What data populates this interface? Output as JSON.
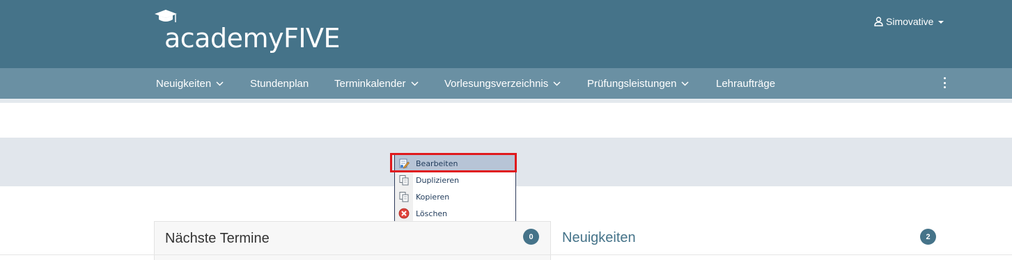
{
  "header": {
    "logo_text": "academyFIVE",
    "user_name": "Simovative",
    "colors": {
      "header_bg": "#457389",
      "nav_bg": "#6a90a3"
    }
  },
  "nav": {
    "items": [
      {
        "label": "Neuigkeiten",
        "has_dropdown": true
      },
      {
        "label": "Stundenplan",
        "has_dropdown": false
      },
      {
        "label": "Terminkalender",
        "has_dropdown": true
      },
      {
        "label": "Vorlesungsverzeichnis",
        "has_dropdown": true
      },
      {
        "label": "Prüfungsleistungen",
        "has_dropdown": true
      },
      {
        "label": "Lehraufträge",
        "has_dropdown": false
      }
    ],
    "more_icon": "kebab-vertical-icon"
  },
  "context_menu": {
    "items": [
      {
        "label": "Bearbeiten",
        "icon": "edit-icon",
        "active": true
      },
      {
        "label": "Duplizieren",
        "icon": "duplicate-icon",
        "active": false
      },
      {
        "label": "Kopieren",
        "icon": "copy-icon",
        "active": false
      },
      {
        "label": "Löschen",
        "icon": "delete-icon",
        "active": false
      }
    ],
    "highlight_color": "#e0191d"
  },
  "panels": {
    "left": {
      "title": "Nächste Termine",
      "count": "0"
    },
    "right": {
      "title": "Neuigkeiten",
      "count": "2"
    }
  }
}
